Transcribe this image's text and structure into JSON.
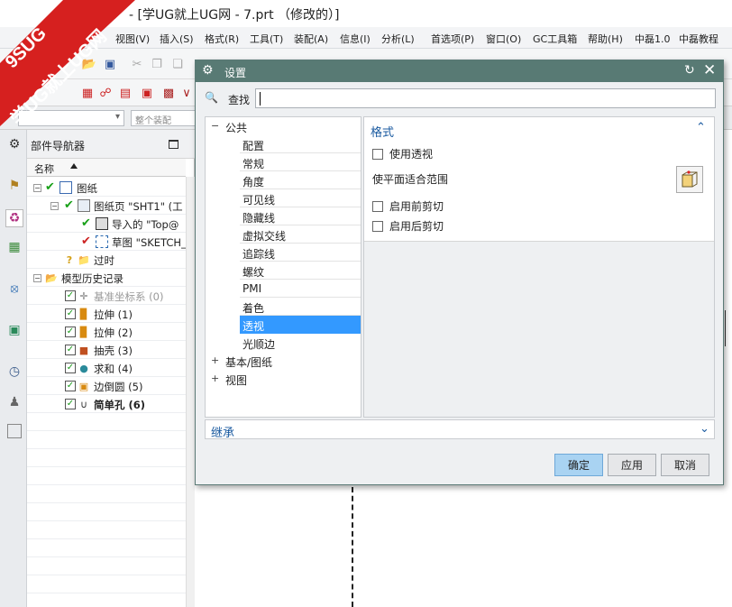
{
  "window": {
    "title": "- [学UG就上UG网 - 7.prt （修改的）]"
  },
  "watermark": {
    "line1": "9SUG",
    "line2": "学UG就上UG网"
  },
  "menu": [
    "视图(V)",
    "插入(S)",
    "格式(R)",
    "工具(T)",
    "装配(A)",
    "信息(I)",
    "分析(L)",
    "首选项(P)",
    "窗口(O)",
    "GC工具箱",
    "帮助(H)",
    "中磊1.0",
    "中磊教程"
  ],
  "filter": {
    "placeholder": "整个装配"
  },
  "navigator": {
    "title": "部件导航器",
    "column": "名称",
    "rows": [
      {
        "label": "图纸"
      },
      {
        "label": "图纸页 \"SHT1\" (工"
      },
      {
        "label": "导入的 \"Top@"
      },
      {
        "label": "草图 \"SKETCH_"
      },
      {
        "label": "过时"
      },
      {
        "label": "模型历史记录"
      },
      {
        "label": "基准坐标系 (0)"
      },
      {
        "label": "拉伸 (1)"
      },
      {
        "label": "拉伸 (2)"
      },
      {
        "label": "抽壳 (3)"
      },
      {
        "label": "求和 (4)"
      },
      {
        "label": "边倒圆 (5)"
      },
      {
        "label": "简单孔 (6)"
      }
    ]
  },
  "dialog": {
    "title": "设置",
    "search_label": "查找",
    "search_value": "",
    "tree": [
      {
        "label": "公共",
        "level": 0,
        "toggle": "−"
      },
      {
        "label": "配置",
        "level": 1
      },
      {
        "label": "常规",
        "level": 1
      },
      {
        "label": "角度",
        "level": 1
      },
      {
        "label": "可见线",
        "level": 1
      },
      {
        "label": "隐藏线",
        "level": 1
      },
      {
        "label": "虚拟交线",
        "level": 1
      },
      {
        "label": "追踪线",
        "level": 1
      },
      {
        "label": "螺纹",
        "level": 1
      },
      {
        "label": "PMI",
        "level": 1
      },
      {
        "label": "着色",
        "level": 1
      },
      {
        "label": "透视",
        "level": 1,
        "selected": true
      },
      {
        "label": "光顺边",
        "level": 1
      },
      {
        "label": "基本/图纸",
        "level": 0,
        "toggle": "+"
      },
      {
        "label": "视图",
        "level": 0,
        "toggle": "+"
      }
    ],
    "format": {
      "header": "格式",
      "use_perspective": "使用透视",
      "fit_plane": "使平面适合范围",
      "front_clip": "启用前剪切",
      "back_clip": "启用后剪切"
    },
    "inherit": "继承",
    "buttons": {
      "ok": "确定",
      "apply": "应用",
      "cancel": "取消"
    },
    "colors": {
      "title_bar": "#587a74",
      "selection": "#3399ff",
      "section_header": "#1a5aa0"
    }
  }
}
